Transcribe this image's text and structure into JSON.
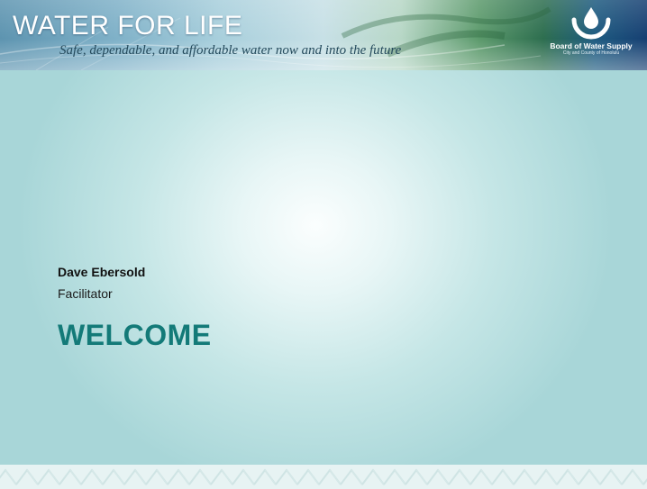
{
  "banner": {
    "title": "WATER FOR LIFE",
    "tagline": "Safe, dependable, and affordable water now and into the future",
    "logo_icon": "water-drop-hand-icon",
    "logo_name": "Board of Water Supply",
    "logo_subtitle": "City and County of Honolulu"
  },
  "presenter": {
    "name": "Dave Ebersold",
    "role": "Facilitator"
  },
  "slide": {
    "heading": "WELCOME"
  },
  "colors": {
    "heading": "#137a78",
    "background_center": "#fbfefe",
    "background_edge": "#a8d6d8",
    "banner_dark": "#163f72"
  }
}
